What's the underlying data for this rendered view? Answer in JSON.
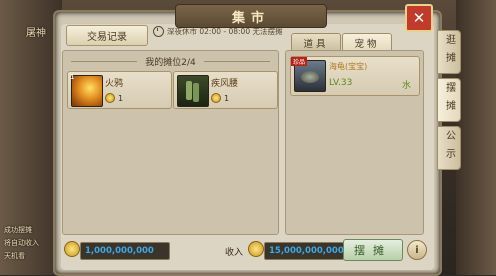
{
  "window": {
    "title": "集市",
    "close_label": "✕"
  },
  "toolbar": {
    "record_button": "交易记录",
    "notice": "深夜休市 02:00 - 08:00 无法摆摊"
  },
  "stall": {
    "header": "我的摊位2/4",
    "items": [
      {
        "name": "火鸦",
        "price": "1",
        "badge": "1"
      },
      {
        "name": "疾风腰",
        "price": "1",
        "badge": ""
      }
    ]
  },
  "tabs": [
    {
      "label": "道具"
    },
    {
      "label": "宠物"
    }
  ],
  "pet": {
    "tag": "珍品",
    "name": "海龟(宝宝)",
    "level": "LV.33",
    "element": "水"
  },
  "side_tabs": [
    {
      "label": "逛摊"
    },
    {
      "label": "摆摊"
    },
    {
      "label": "公示"
    }
  ],
  "bottom": {
    "balance": "1,000,000,000",
    "income_label": "收入",
    "income_value": "15,000,000,000",
    "stall_button": "摆摊",
    "info_label": "i"
  },
  "background": {
    "left_texts": [
      "屠神",
      "成功摆摊",
      "将自动收入",
      "天机看"
    ]
  }
}
